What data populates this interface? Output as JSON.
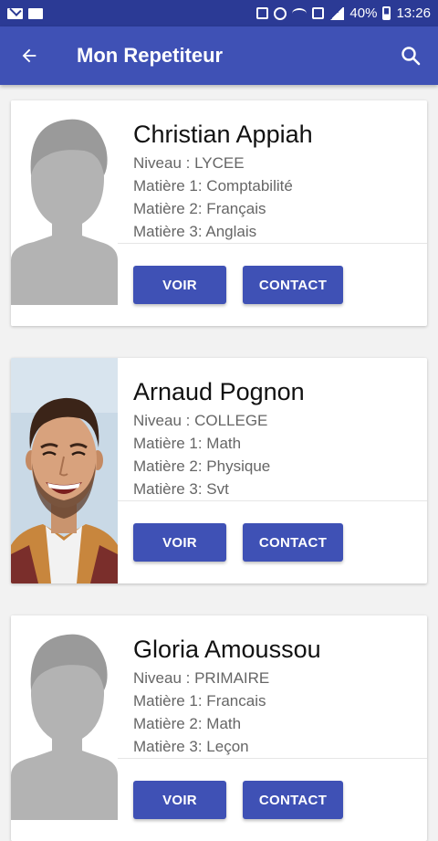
{
  "status_bar": {
    "battery": "40%",
    "time": "13:26",
    "icons_left": [
      "mail-icon",
      "folder-icon"
    ],
    "icons_right": [
      "nfc-icon",
      "alarm-icon",
      "wifi-icon",
      "data-icon",
      "signal-icon",
      "battery-icon"
    ]
  },
  "app_bar": {
    "title": "Mon Repetiteur",
    "back_icon": "arrow-left",
    "search_icon": "magnifier"
  },
  "tutors": [
    {
      "name": "Christian Appiah",
      "niveau": "Niveau : LYCEE",
      "matiere1": "Matière 1: Comptabilité",
      "matiere2": "Matière 2: Français",
      "matiere3": "Matière 3: Anglais",
      "photo": "placeholder-silhouette",
      "voir_label": "VOIR",
      "contact_label": "CONTACT"
    },
    {
      "name": "Arnaud Pognon",
      "niveau": "Niveau : COLLEGE",
      "matiere1": "Matière 1: Math",
      "matiere2": "Matière 2: Physique",
      "matiere3": "Matière 3: Svt",
      "photo": "smiling-man-portrait",
      "voir_label": "VOIR",
      "contact_label": "CONTACT"
    },
    {
      "name": "Gloria Amoussou",
      "niveau": "Niveau : PRIMAIRE",
      "matiere1": "Matière 1: Francais",
      "matiere2": "Matière 2: Math",
      "matiere3": "Matière 3: Leçon",
      "photo": "placeholder-silhouette",
      "voir_label": "VOIR",
      "contact_label": "CONTACT"
    }
  ],
  "colors": {
    "status_bar": "#2b3a95",
    "primary": "#3f51b5",
    "background": "#f2f2f2"
  }
}
